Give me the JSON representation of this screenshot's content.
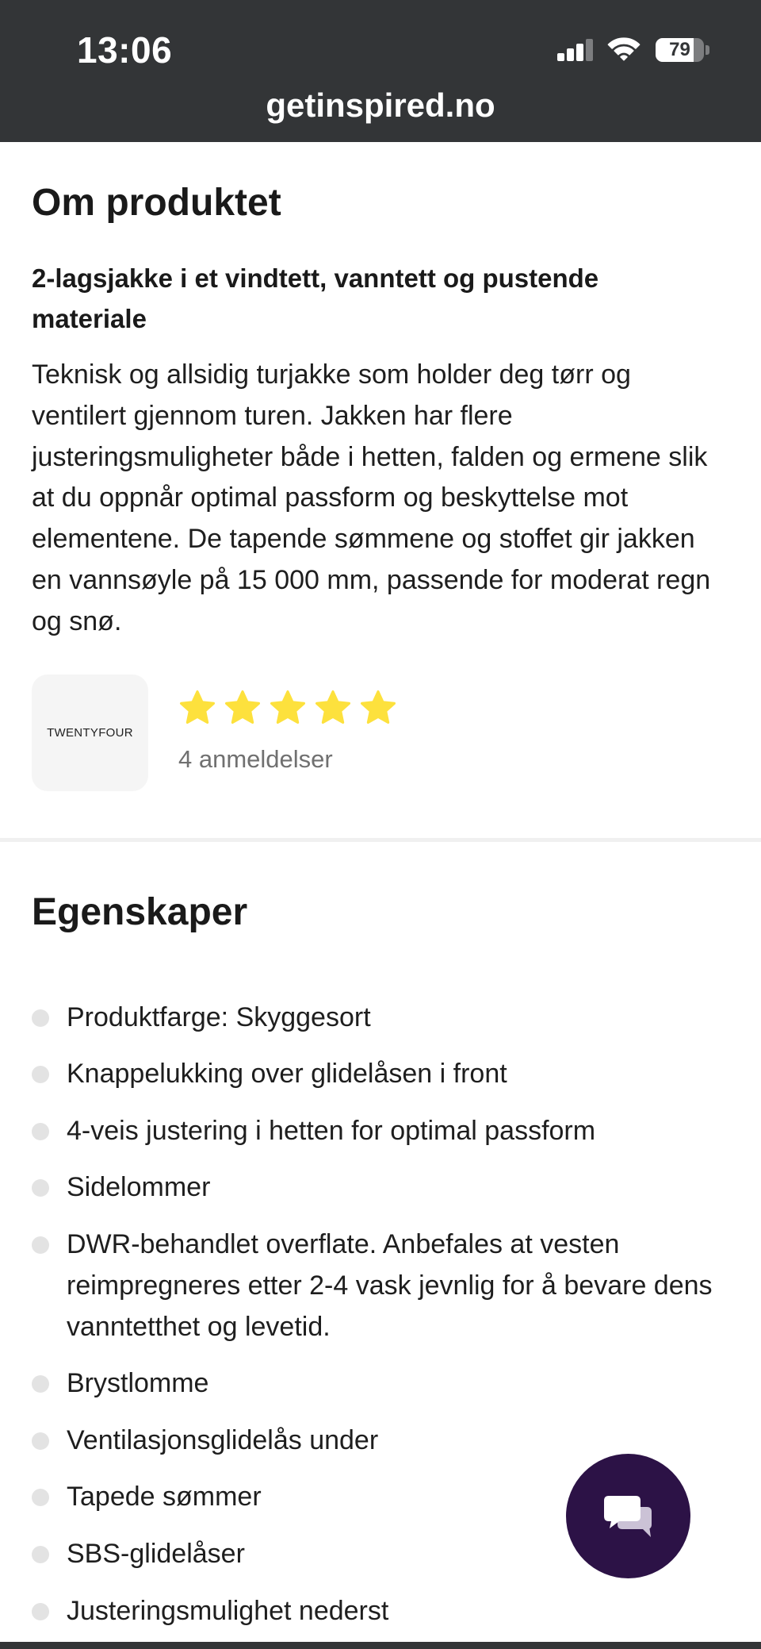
{
  "status_bar": {
    "time": "13:06",
    "signal": {
      "active_bars": 3,
      "total_bars": 4
    },
    "battery": {
      "level": 79,
      "label": "79"
    }
  },
  "browser": {
    "url": "getinspired.no"
  },
  "about": {
    "heading": "Om produktet",
    "subtitle": "2-lagsjakke i et vindtett, vanntett og pustende materiale",
    "description": "Teknisk og allsidig turjakke som holder deg tørr og ventilert gjennom turen. Jakken har flere justeringsmuligheter både i hetten, falden og ermene slik at du oppnår optimal passform og beskyttelse mot elementene. De tapende sømmene og stoffet gir jakken en vannsøyle på 15 000 mm, passende for moderat regn og snø.",
    "brand": {
      "logo_text": "TWENTYFOUR"
    },
    "rating": {
      "value": 5,
      "max": 5,
      "reviews_label": "4 anmeldelser"
    }
  },
  "features": {
    "heading": "Egenskaper",
    "items": [
      "Produktfarge: Skyggesort",
      "Knappelukking over glidelåsen i front",
      "4-veis justering i hetten for optimal passform",
      "Sidelommer",
      "DWR-behandlet overflate. Anbefales at vesten reimpregneres etter 2-4 vask jevnlig for å bevare dens vanntetthet og levetid.",
      "Brystlomme",
      "Ventilasjonsglidelås under",
      "Tapede sømmer",
      "SBS-glidelåser",
      "Justeringsmulighet nederst"
    ]
  },
  "icons": {
    "signal": "cellular-signal-icon",
    "wifi": "wifi-icon",
    "battery": "battery-icon",
    "star": "star-icon",
    "chat": "chat-bubbles-icon"
  },
  "theme": {
    "status_bar_bg": "#333537",
    "star_color": "#fde13d",
    "chat_button_bg": "#2c1246",
    "bullet_color": "#e3e3e3"
  }
}
